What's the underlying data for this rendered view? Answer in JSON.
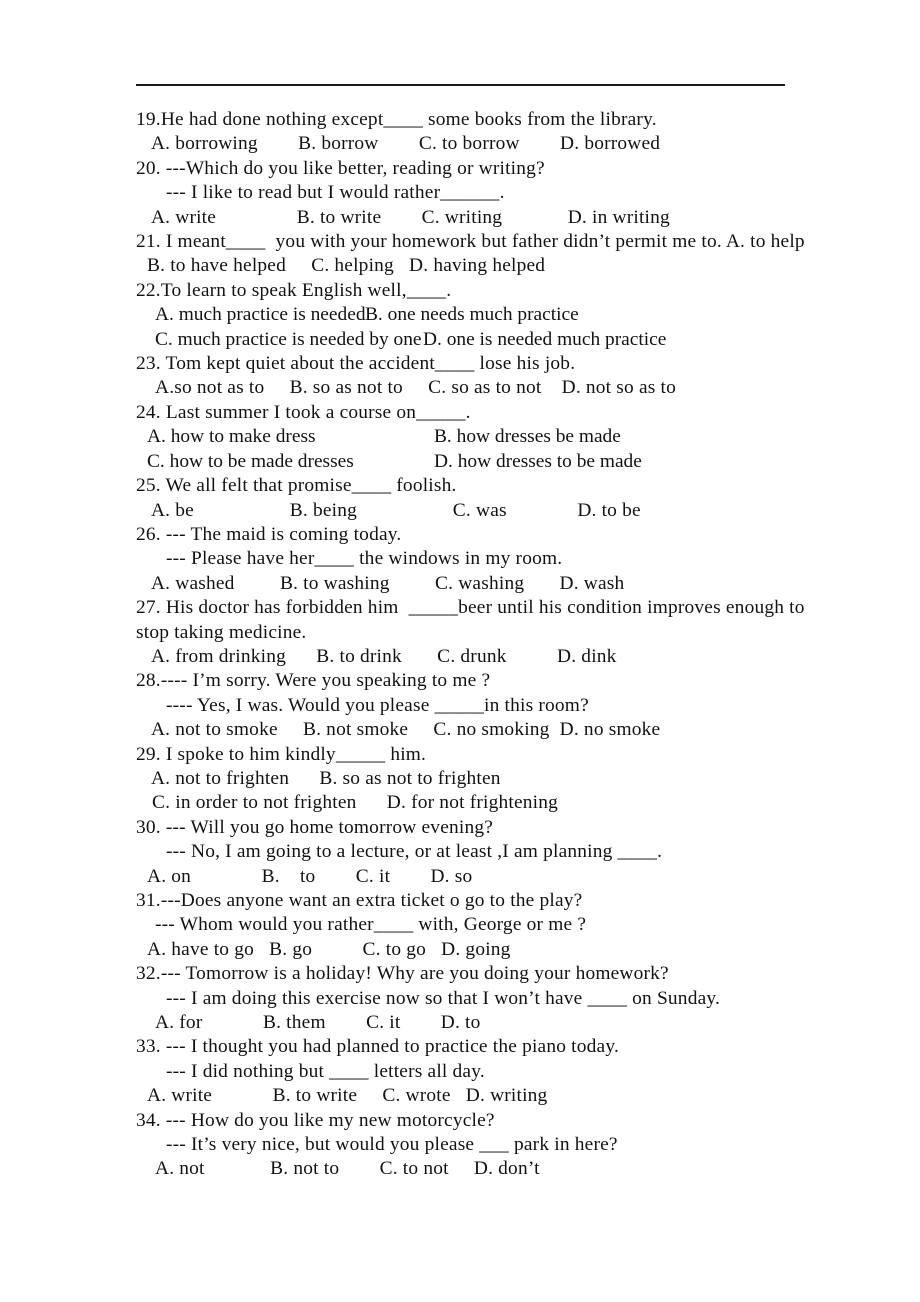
{
  "document": {
    "type": "worksheet",
    "subject": "English grammar multiple choice",
    "question_range": "19-34",
    "header_rule": true
  },
  "questions": [
    {
      "id": "q19",
      "stem": "19.He had done nothing except____ some books from the library.",
      "options_line": " A. borrowing        B. borrow        C. to borrow        D. borrowed"
    },
    {
      "id": "q20",
      "stem": "20. ---Which do you like better, reading or writing?",
      "reply": "--- I like to read but I would rather______.",
      "options_line": " A. write                B. to write        C. writing             D. in writing"
    },
    {
      "id": "q21",
      "stem": "21. I meant____  you with your homework but father didn’t permit me to. A. to help",
      "options_line": "B. to have helped     C. helping   D. having helped"
    },
    {
      "id": "q22",
      "stem": "22.To learn to speak English well,____.",
      "options_row_1_col_1": "A. much practice is needed",
      "options_row_1_col_2": "B. one needs much practice",
      "options_row_2_col_1": "C. much practice is needed by one",
      "options_row_2_col_2": "D. one is needed much practice"
    },
    {
      "id": "q23",
      "stem": "23. Tom kept quiet about the accident____ lose his job.",
      "options_line": "A.so not as to     B. so as not to     C. so as to not    D. not so as to"
    },
    {
      "id": "q24",
      "stem": "24. Last summer I took a course on_____.",
      "options_row_1_col_1": "A. how to make dress",
      "options_row_1_col_2": "B. how dresses be made",
      "options_row_2_col_1": "C. how to be made dresses",
      "options_row_2_col_2": "D. how dresses to be made"
    },
    {
      "id": "q25",
      "stem": "25. We all felt that promise____ foolish.",
      "options_line": " A. be                   B. being                   C. was              D. to be"
    },
    {
      "id": "q26",
      "stem": "26. --- The maid is coming today.",
      "reply": "--- Please have her____ the windows in my room.",
      "options_line": " A. washed         B. to washing         C. washing       D. wash"
    },
    {
      "id": "q27",
      "stem": "27. His doctor has forbidden him  _____beer until his condition improves enough to",
      "stem_wrap": "stop taking medicine.",
      "options_line": " A. from drinking      B. to drink       C. drunk          D. dink"
    },
    {
      "id": "q28",
      "stem": "28.---- I’m sorry. Were you speaking to me ?",
      "reply": "---- Yes, I was. Would you please _____in this room?",
      "options_line": " A. not to smoke     B. not smoke     C. no smoking  D. no smoke"
    },
    {
      "id": "q29",
      "stem": "29. I spoke to him kindly_____ him.",
      "options_row_1": " A. not to frighten      B. so as not to frighten",
      "options_row_2": " C. in order to not frighten      D. for not frightening"
    },
    {
      "id": "q30",
      "stem": "30. --- Will you go home tomorrow evening?",
      "reply": "--- No, I am going to a lecture, or at least ,I am planning ____.",
      "options_line": "A. on              B.    to        C. it        D. so"
    },
    {
      "id": "q31",
      "stem": "31.---Does anyone want an extra ticket o go to the play?",
      "reply": "--- Whom would you rather____ with, George or me ?",
      "options_line": "A. have to go   B. go          C. to go   D. going"
    },
    {
      "id": "q32",
      "stem": "32.--- Tomorrow is a holiday! Why are you doing your homework?",
      "reply": "--- I am doing this exercise now so that I won’t have ____ on Sunday.",
      "options_line": "A. for            B. them        C. it        D. to"
    },
    {
      "id": "q33",
      "stem": "33. --- I thought you had planned to practice the piano today.",
      "reply": "--- I did nothing but ____ letters all day.",
      "options_line": "A. write            B. to write     C. wrote   D. writing"
    },
    {
      "id": "q34",
      "stem": "34. --- How do you like my new motorcycle?",
      "reply": "--- It’s very nice, but would you please ___ park in here?",
      "options_line": "A. not             B. not to        C. to not     D. don’t"
    }
  ]
}
